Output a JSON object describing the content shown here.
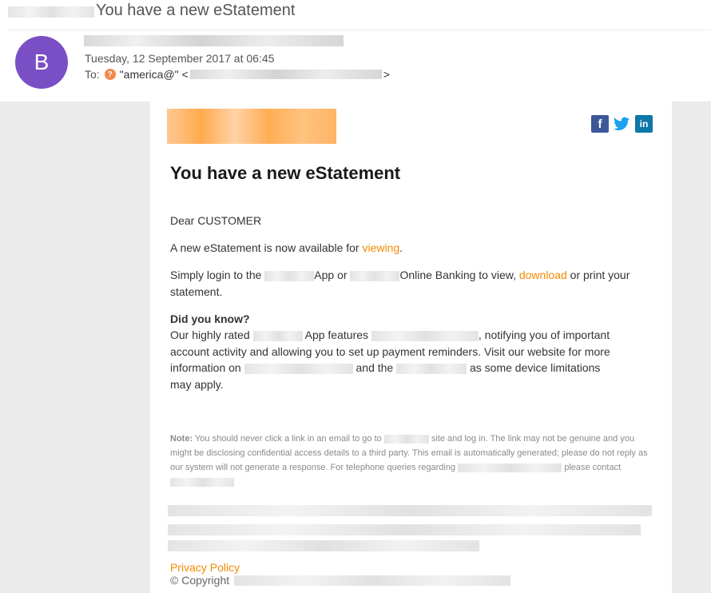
{
  "header": {
    "subject": "You have a new eStatement",
    "avatar_letter": "B",
    "date": "Tuesday, 12 September 2017 at 06:45",
    "to_label": "To:",
    "to_name": "\"america@\" <",
    "to_close": ">"
  },
  "email": {
    "title": "You have a new eStatement",
    "greeting": "Dear CUSTOMER",
    "available_prefix": "A new eStatement is now available for ",
    "viewing_link": "viewing",
    "available_suffix": ".",
    "login_prefix": "Simply login to the ",
    "login_app": "App or ",
    "login_online": "Online Banking to view, ",
    "download_link": "download",
    "login_suffix": " or print your statement.",
    "did_you_know": "Did you know?",
    "know_1": "Our highly rated ",
    "know_2": " App features ",
    "know_3": ", notifying you of important account activity and allowing you to set up payment reminders. Visit our website for more information on ",
    "know_4": " and the ",
    "know_5": " as some device limitations may apply.",
    "note_label": "Note:",
    "note_1": " You should never click a link in an email to go to ",
    "note_2": " site and log in. The link may not be genuine and you might be disclosing confidential access details to a third party. This email is automatically generated; please do not reply as our system will not generate a response. For telephone queries regarding ",
    "note_3": " please contact",
    "privacy_link": "Privacy Policy",
    "copyright": "© Copyright"
  },
  "social": {
    "facebook": "f",
    "twitter": "🐦",
    "linkedin": "in"
  },
  "colors": {
    "avatar": "#7a4fc6",
    "link": "#f28b00",
    "facebook": "#3b5998",
    "twitter": "#1da1f2",
    "linkedin": "#0e76a8"
  }
}
